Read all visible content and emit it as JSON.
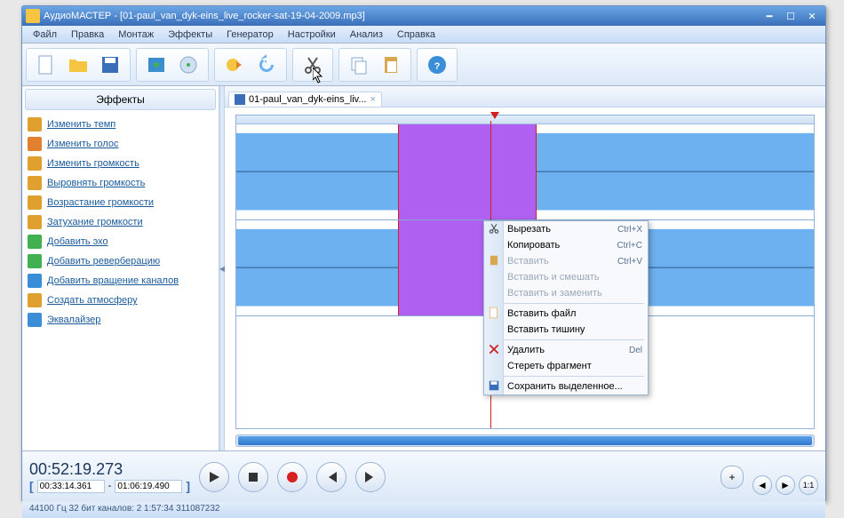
{
  "window": {
    "title": "АудиоМАСТЕР - [01-paul_van_dyk-eins_live_rocker-sat-19-04-2009.mp3]"
  },
  "menu": [
    "Файл",
    "Правка",
    "Монтаж",
    "Эффекты",
    "Генератор",
    "Настройки",
    "Анализ",
    "Справка"
  ],
  "sidebar": {
    "header": "Эффекты",
    "items": [
      {
        "label": "Изменить темп",
        "icon": "clock",
        "color": "#e0a030"
      },
      {
        "label": "Изменить голос",
        "icon": "person",
        "color": "#e08030"
      },
      {
        "label": "Изменить громкость",
        "icon": "speaker",
        "color": "#e0a030"
      },
      {
        "label": "Выровнять громкость",
        "icon": "speaker",
        "color": "#e0a030"
      },
      {
        "label": "Возрастание громкости",
        "icon": "speaker",
        "color": "#e0a030"
      },
      {
        "label": "Затухание громкости",
        "icon": "speaker",
        "color": "#e0a030"
      },
      {
        "label": "Добавить эхо",
        "icon": "echo",
        "color": "#40b050"
      },
      {
        "label": "Добавить реверберацию",
        "icon": "reverb",
        "color": "#40b050"
      },
      {
        "label": "Добавить вращение каналов",
        "icon": "rotate",
        "color": "#3a8ed8"
      },
      {
        "label": "Создать атмосферу",
        "icon": "atmosphere",
        "color": "#e0a030"
      },
      {
        "label": "Эквалайзер",
        "icon": "eq",
        "color": "#3a8ed8"
      }
    ]
  },
  "tab": {
    "label": "01-paul_van_dyk-eins_liv..."
  },
  "transport": {
    "main_time": "00:52:19.273",
    "sel_start": "00:33:14.361",
    "sel_end": "01:06:19.490",
    "dash": "-"
  },
  "status": "44100 Гц  32 бит  каналов: 2   1:57:34  311087232",
  "zoom": {
    "plus": "+",
    "fit": "1:1"
  },
  "context_menu": [
    {
      "label": "Вырезать",
      "shortcut": "Ctrl+X",
      "icon": "scissors"
    },
    {
      "label": "Копировать",
      "shortcut": "Ctrl+C",
      "icon": ""
    },
    {
      "label": "Вставить",
      "shortcut": "Ctrl+V",
      "icon": "paste",
      "disabled": true
    },
    {
      "label": "Вставить и смешать",
      "shortcut": "",
      "disabled": true
    },
    {
      "label": "Вставить и заменить",
      "shortcut": "",
      "disabled": true
    },
    {
      "sep": true
    },
    {
      "label": "Вставить файл",
      "shortcut": "",
      "icon": "file"
    },
    {
      "label": "Вставить тишину",
      "shortcut": ""
    },
    {
      "sep": true
    },
    {
      "label": "Удалить",
      "shortcut": "Del",
      "icon": "delete"
    },
    {
      "label": "Стереть фрагмент",
      "shortcut": ""
    },
    {
      "sep": true
    },
    {
      "label": "Сохранить выделенное...",
      "shortcut": "",
      "icon": "save"
    }
  ]
}
